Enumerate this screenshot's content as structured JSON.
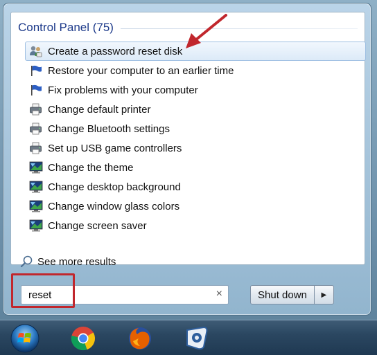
{
  "results": {
    "section_title": "Control Panel (75)",
    "items": [
      {
        "label": "Create a password reset disk",
        "icon": "users-icon",
        "selected": true
      },
      {
        "label": "Restore your computer to an earlier time",
        "icon": "flag-icon"
      },
      {
        "label": "Fix problems with your computer",
        "icon": "flag-icon"
      },
      {
        "label": "Change default printer",
        "icon": "printer-icon"
      },
      {
        "label": "Change Bluetooth settings",
        "icon": "printer-icon"
      },
      {
        "label": "Set up USB game controllers",
        "icon": "printer-icon"
      },
      {
        "label": "Change the theme",
        "icon": "display-icon"
      },
      {
        "label": "Change desktop background",
        "icon": "display-icon"
      },
      {
        "label": "Change window glass colors",
        "icon": "display-icon"
      },
      {
        "label": "Change screen saver",
        "icon": "display-icon"
      }
    ],
    "see_more_label": "See more results"
  },
  "search": {
    "value": "reset",
    "clear_glyph": "×"
  },
  "power": {
    "shutdown_label": "Shut down",
    "arrow_glyph": "▶"
  },
  "taskbar": {
    "items": [
      "start-orb-icon",
      "chrome-icon",
      "firefox-icon",
      "app-icon"
    ]
  },
  "colors": {
    "annotation": "#c1272d",
    "section_title": "#1d3a8a",
    "selection_bg": "#dceaf8"
  }
}
